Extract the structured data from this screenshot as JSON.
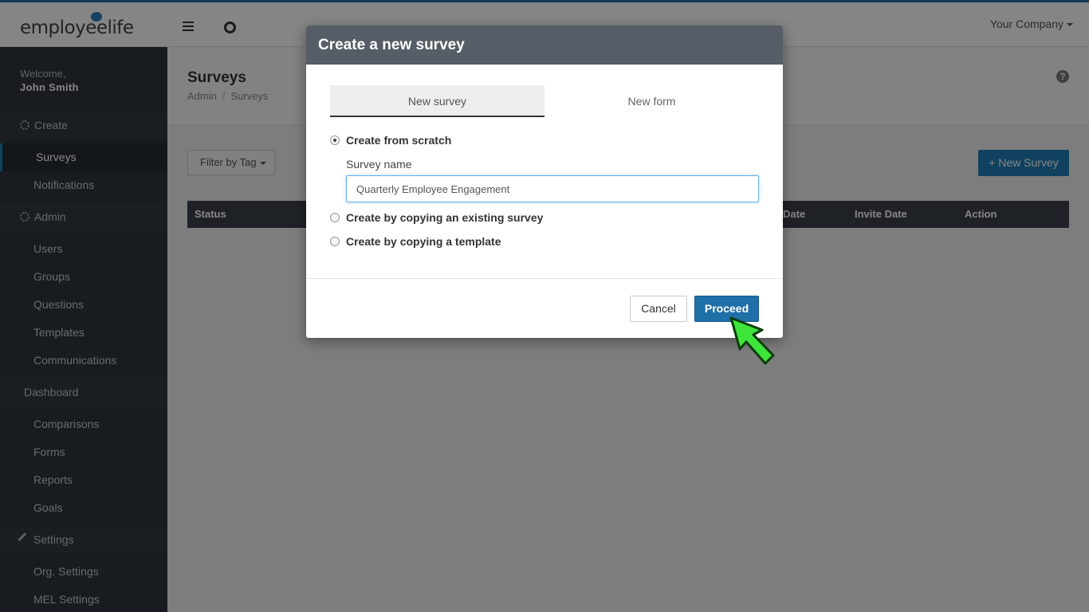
{
  "brand": {
    "logo_text": "employeelife",
    "accent": "#1f7fb6"
  },
  "topbar": {
    "company": "Your Company"
  },
  "sidebar": {
    "welcome": "Welcome,",
    "user": "John Smith",
    "create_label": "Create",
    "create_items": [
      "Surveys",
      "Notifications"
    ],
    "admin_label": "Admin",
    "admin_items": [
      "Users",
      "Groups",
      "Questions",
      "Templates",
      "Communications"
    ],
    "dashboard_label": "Dashboard",
    "dashboard_items": [
      "Comparisons",
      "Forms",
      "Reports",
      "Goals"
    ],
    "settings_label": "Settings",
    "settings_items": [
      "Org. Settings",
      "MEL Settings"
    ]
  },
  "page": {
    "title": "Surveys",
    "breadcrumb": [
      "Admin",
      "Surveys"
    ],
    "breadcrumb_sep": "/",
    "help": "?",
    "filter_label": "Filter by Tag",
    "new_survey_label": "+ New Survey",
    "columns": [
      "Status",
      "Date",
      "Invite Date",
      "Action"
    ]
  },
  "modal": {
    "title": "Create a new survey",
    "tabs": [
      "New survey",
      "New form"
    ],
    "options": [
      "Create from scratch",
      "Create by copying an existing survey",
      "Create by copying a template"
    ],
    "survey_name_label": "Survey name",
    "survey_name_value": "Quarterly Employee Engagement",
    "cancel_label": "Cancel",
    "proceed_label": "Proceed"
  }
}
